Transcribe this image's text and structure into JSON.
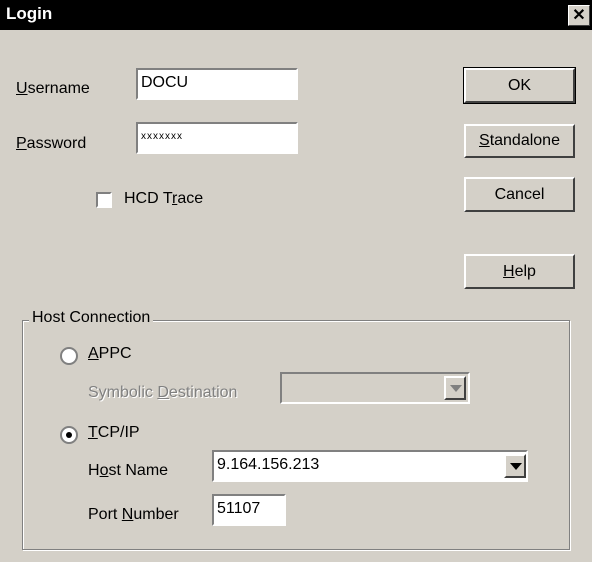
{
  "window": {
    "title": "Login",
    "close_glyph": "✕"
  },
  "form": {
    "username_label_u": "U",
    "username_label_rest": "sername",
    "username_value": "DOCU",
    "password_label_u": "P",
    "password_label_rest": "assword",
    "password_value": "xxxxxxx",
    "hcd_trace_label_pre": "HCD T",
    "hcd_trace_label_u": "r",
    "hcd_trace_label_post": "ace",
    "hcd_trace_checked": false
  },
  "buttons": {
    "ok": "OK",
    "standalone_u": "S",
    "standalone_rest": "tandalone",
    "cancel": "Cancel",
    "help_u": "H",
    "help_rest": "elp"
  },
  "host_connection": {
    "title": "Host Connection",
    "appc_u": "A",
    "appc_rest": "PPC",
    "appc_selected": false,
    "symbolic_pre": "Symbolic ",
    "symbolic_u": "D",
    "symbolic_post": "estination",
    "symbolic_value": "",
    "tcpip_u": "T",
    "tcpip_rest": "CP/IP",
    "tcpip_selected": true,
    "hostname_pre": "H",
    "hostname_u": "o",
    "hostname_post": "st Name",
    "hostname_value": "9.164.156.213",
    "port_pre": "Port ",
    "port_u": "N",
    "port_post": "umber",
    "port_value": "51107"
  }
}
